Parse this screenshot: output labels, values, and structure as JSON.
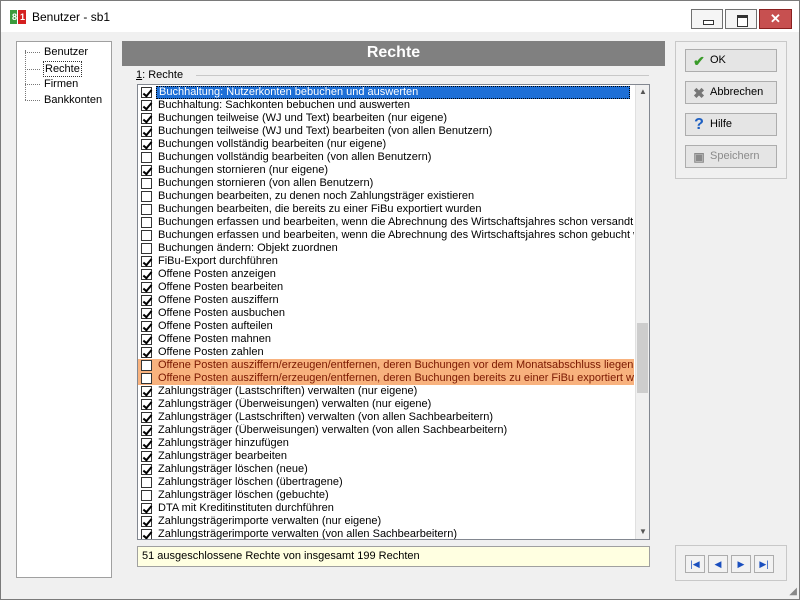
{
  "window": {
    "title": "Benutzer - sb1"
  },
  "tree": [
    {
      "label": "Benutzer",
      "selected": false
    },
    {
      "label": "Rechte",
      "selected": true
    },
    {
      "label": "Firmen",
      "selected": false
    },
    {
      "label": "Bankkonten",
      "selected": false
    }
  ],
  "panel": {
    "header": "Rechte",
    "group_prefix": "1",
    "group_title": ": Rechte"
  },
  "rights": [
    {
      "label": "Buchhaltung: Nutzerkonten bebuchen und auswerten",
      "checked": true,
      "selected": true,
      "highlight": false
    },
    {
      "label": "Buchhaltung: Sachkonten bebuchen und auswerten",
      "checked": true,
      "selected": false,
      "highlight": false
    },
    {
      "label": "Buchungen teilweise (WJ und Text) bearbeiten (nur eigene)",
      "checked": true,
      "selected": false,
      "highlight": false
    },
    {
      "label": "Buchungen teilweise (WJ und Text) bearbeiten (von allen Benutzern)",
      "checked": true,
      "selected": false,
      "highlight": false
    },
    {
      "label": "Buchungen vollständig bearbeiten (nur eigene)",
      "checked": true,
      "selected": false,
      "highlight": false
    },
    {
      "label": "Buchungen vollständig bearbeiten (von allen Benutzern)",
      "checked": false,
      "selected": false,
      "highlight": false
    },
    {
      "label": "Buchungen stornieren (nur eigene)",
      "checked": true,
      "selected": false,
      "highlight": false
    },
    {
      "label": "Buchungen stornieren (von allen Benutzern)",
      "checked": false,
      "selected": false,
      "highlight": false
    },
    {
      "label": "Buchungen bearbeiten, zu denen noch Zahlungsträger existieren",
      "checked": false,
      "selected": false,
      "highlight": false
    },
    {
      "label": "Buchungen bearbeiten, die bereits zu einer FiBu exportiert wurden",
      "checked": false,
      "selected": false,
      "highlight": false
    },
    {
      "label": "Buchungen erfassen und bearbeiten, wenn die Abrechnung des Wirtschaftsjahres schon versandt wu",
      "checked": false,
      "selected": false,
      "highlight": false
    },
    {
      "label": "Buchungen erfassen und bearbeiten, wenn die Abrechnung des Wirtschaftsjahres schon gebucht wu",
      "checked": false,
      "selected": false,
      "highlight": false
    },
    {
      "label": "Buchungen ändern: Objekt zuordnen",
      "checked": false,
      "selected": false,
      "highlight": false
    },
    {
      "label": "FiBu-Export durchführen",
      "checked": true,
      "selected": false,
      "highlight": false
    },
    {
      "label": "Offene Posten anzeigen",
      "checked": true,
      "selected": false,
      "highlight": false
    },
    {
      "label": "Offene Posten bearbeiten",
      "checked": true,
      "selected": false,
      "highlight": false
    },
    {
      "label": "Offene Posten ausziffern",
      "checked": true,
      "selected": false,
      "highlight": false
    },
    {
      "label": "Offene Posten ausbuchen",
      "checked": true,
      "selected": false,
      "highlight": false
    },
    {
      "label": "Offene Posten aufteilen",
      "checked": true,
      "selected": false,
      "highlight": false
    },
    {
      "label": "Offene Posten mahnen",
      "checked": true,
      "selected": false,
      "highlight": false
    },
    {
      "label": "Offene Posten zahlen",
      "checked": true,
      "selected": false,
      "highlight": false
    },
    {
      "label": "Offene Posten ausziffern/erzeugen/entfernen, deren Buchungen vor dem Monatsabschluss liegen",
      "checked": false,
      "selected": false,
      "highlight": true
    },
    {
      "label": "Offene Posten ausziffern/erzeugen/entfernen, deren Buchungen bereits zu einer FiBu exportiert wurd",
      "checked": false,
      "selected": false,
      "highlight": true
    },
    {
      "label": "Zahlungsträger (Lastschriften) verwalten (nur eigene)",
      "checked": true,
      "selected": false,
      "highlight": false
    },
    {
      "label": "Zahlungsträger (Überweisungen) verwalten (nur eigene)",
      "checked": true,
      "selected": false,
      "highlight": false
    },
    {
      "label": "Zahlungsträger (Lastschriften) verwalten (von allen Sachbearbeitern)",
      "checked": true,
      "selected": false,
      "highlight": false
    },
    {
      "label": "Zahlungsträger (Überweisungen) verwalten (von allen Sachbearbeitern)",
      "checked": true,
      "selected": false,
      "highlight": false
    },
    {
      "label": "Zahlungsträger hinzufügen",
      "checked": true,
      "selected": false,
      "highlight": false
    },
    {
      "label": "Zahlungsträger bearbeiten",
      "checked": true,
      "selected": false,
      "highlight": false
    },
    {
      "label": "Zahlungsträger löschen (neue)",
      "checked": true,
      "selected": false,
      "highlight": false
    },
    {
      "label": "Zahlungsträger löschen (übertragene)",
      "checked": false,
      "selected": false,
      "highlight": false
    },
    {
      "label": "Zahlungsträger löschen (gebuchte)",
      "checked": false,
      "selected": false,
      "highlight": false
    },
    {
      "label": "DTA mit Kreditinstituten durchführen",
      "checked": true,
      "selected": false,
      "highlight": false
    },
    {
      "label": "Zahlungsträgerimporte verwalten (nur eigene)",
      "checked": true,
      "selected": false,
      "highlight": false
    },
    {
      "label": "Zahlungsträgerimporte verwalten (von allen Sachbearbeitern)",
      "checked": true,
      "selected": false,
      "highlight": false
    }
  ],
  "status": "51 ausgeschlossene Rechte von insgesamt 199 Rechten",
  "buttons": {
    "ok": "OK",
    "cancel": "Abbrechen",
    "help": "Hilfe",
    "save": "Speichern"
  },
  "nav": {
    "first_icon": "first-record-icon",
    "prev_icon": "previous-record-icon",
    "next_icon": "next-record-icon",
    "last_icon": "last-record-icon"
  }
}
